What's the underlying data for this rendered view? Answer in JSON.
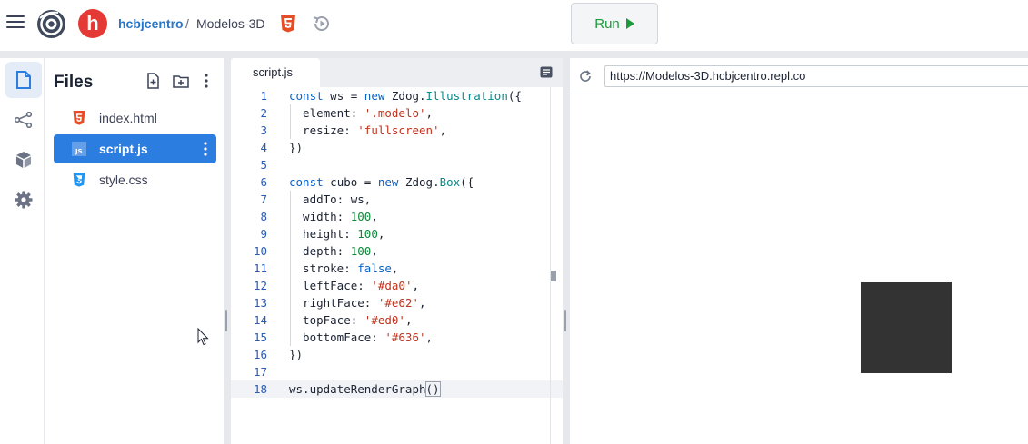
{
  "header": {
    "owner": "hcbjcentro",
    "separator": "/",
    "repl_name": "Modelos-3D",
    "avatar_letter": "h",
    "run_label": "Run"
  },
  "files_pane": {
    "title": "Files",
    "files": [
      {
        "name": "index.html",
        "icon": "html5-icon"
      },
      {
        "name": "script.js",
        "icon": "js-icon"
      },
      {
        "name": "style.css",
        "icon": "css3-icon"
      }
    ]
  },
  "editor": {
    "tab_label": "script.js",
    "lines": [
      "const ws = new Zdog.Illustration({",
      "  element: '.modelo',",
      "  resize: 'fullscreen',",
      "})",
      "",
      "const cubo = new Zdog.Box({",
      "  addTo: ws,",
      "  width: 100,",
      "  height: 100,",
      "  depth: 100,",
      "  stroke: false,",
      "  leftFace: '#da0',",
      "  rightFace: '#e62',",
      "  topFace: '#ed0',",
      "  bottomFace: '#636',",
      "})",
      "",
      "ws.updateRenderGraph()"
    ],
    "active_line": 18
  },
  "webview": {
    "url": "https://Modelos-3D.hcbjcentro.repl.co"
  },
  "colors": {
    "accent": "#2b7de0",
    "run_green": "#1a9a3c",
    "cube": "#333333"
  }
}
